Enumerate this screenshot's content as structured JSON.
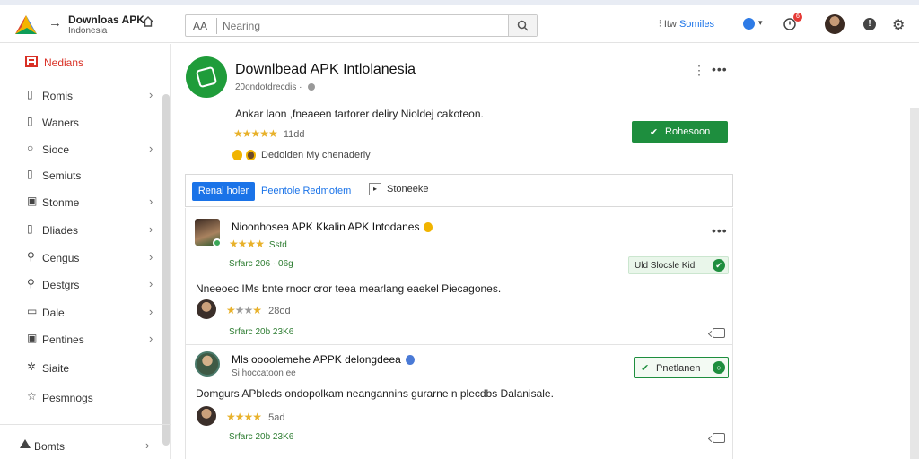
{
  "header": {
    "app_title": "Downloas APK",
    "app_subtitle": "Indonesia",
    "search_aa": "AA",
    "search_placeholder": "Nearing",
    "trend_prefix": "Itw",
    "trend_link": "Somiles",
    "bell_count": "6"
  },
  "sidebar": {
    "header_label": "Nedians",
    "items": [
      {
        "label": "Romis",
        "icon": "square-icon",
        "glyph": "▯",
        "chevron": true
      },
      {
        "label": "Waners",
        "icon": "file-icon",
        "glyph": "▯",
        "chevron": false
      },
      {
        "label": "Sioce",
        "icon": "circle-icon",
        "glyph": "○",
        "chevron": true
      },
      {
        "label": "Semiuts",
        "icon": "doc-icon",
        "glyph": "▯",
        "chevron": false
      },
      {
        "label": "Stonme",
        "icon": "box-icon",
        "glyph": "▣",
        "chevron": true
      },
      {
        "label": "Dliades",
        "icon": "page-icon",
        "glyph": "▯",
        "chevron": true
      },
      {
        "label": "Cengus",
        "icon": "search-icon",
        "glyph": "⚲",
        "chevron": true
      },
      {
        "label": "Destgrs",
        "icon": "search-icon",
        "glyph": "⚲",
        "chevron": true
      },
      {
        "label": "Dale",
        "icon": "frame-icon",
        "glyph": "▭",
        "chevron": true
      },
      {
        "label": "Pentines",
        "icon": "window-icon",
        "glyph": "▣",
        "chevron": true
      },
      {
        "label": "Siaite",
        "icon": "sparkle-icon",
        "glyph": "✲",
        "chevron": false
      },
      {
        "label": "Pesmnogs",
        "icon": "star-icon",
        "glyph": "☆",
        "chevron": false
      }
    ],
    "footer_label": "Bomts"
  },
  "app": {
    "title": "Downlbead APK Intlolanesia",
    "meta": "20ondotdrecdis ·",
    "description": "Ankar laon ,fneaeen tartorer deliry Nioldej cakoteon.",
    "stars": "★★★★★",
    "rating_text": "11dd",
    "badge_text": "Dedolden My chenaderly",
    "cta_label": "Rohesoon"
  },
  "tabs": {
    "active": "Renal holer",
    "link": "Peentole Redmotem",
    "third": "Stoneeke"
  },
  "cards": [
    {
      "title": "Nioonhosea APK Kkalin APK Intodanes",
      "stars": "★★★★",
      "sub": "Sstd",
      "date": "Srfarc 206 · 06g",
      "status": "Uld Slocsle Kid",
      "body": "Nneeoec IMs bnte rnocr cror teea mearlang eaekel Piecagones.",
      "rating_text": "28od",
      "date2": "Srfarc 20b 23K6"
    },
    {
      "title": "Mls oooolemehe APPK delongdeea",
      "sub": "Si hoccatoon ee",
      "status": "Pnetlanen",
      "body": "Domgurs APbleds ondopolkam neangannins gurarne n plecdbs Dalanisale.",
      "rating_text": "5ad",
      "date2": "Srfarc 20b 23K6"
    }
  ],
  "colors": {
    "accent_green": "#1e8e3e",
    "accent_blue": "#1a73e8",
    "accent_red": "#d93025",
    "star_gold": "#e8b12a"
  }
}
